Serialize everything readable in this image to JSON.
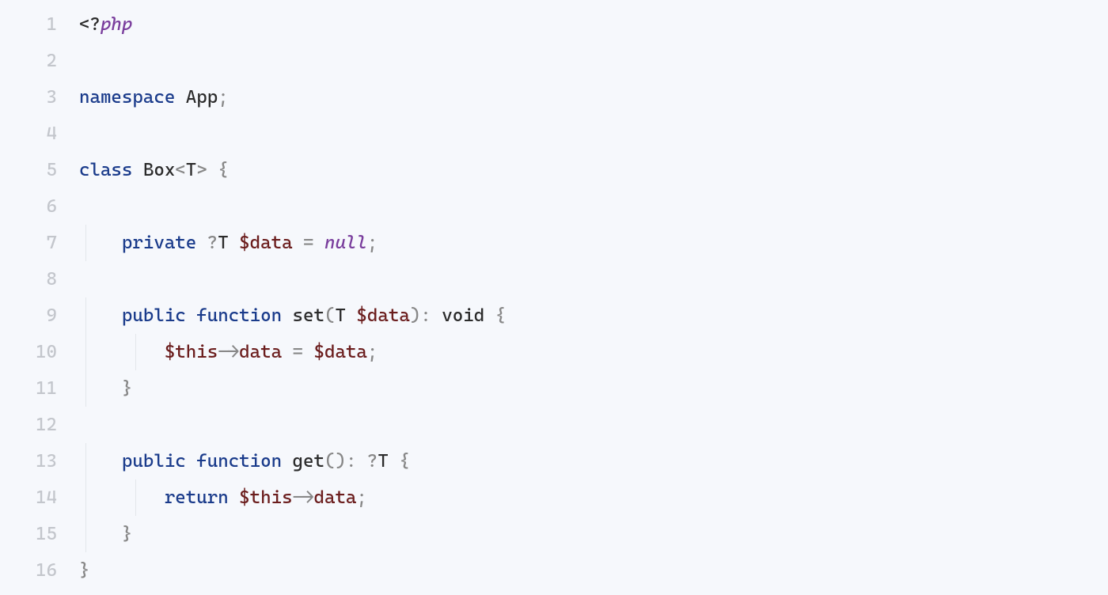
{
  "editor": {
    "lines": [
      {
        "num": "1",
        "guides": [],
        "tokens": [
          {
            "cls": "tk-tag",
            "t": "<?"
          },
          {
            "cls": "tk-php",
            "t": "php"
          }
        ]
      },
      {
        "num": "2",
        "guides": [],
        "tokens": []
      },
      {
        "num": "3",
        "guides": [],
        "tokens": [
          {
            "cls": "tk-kw",
            "t": "namespace"
          },
          {
            "cls": "tk-plain",
            "t": " App"
          },
          {
            "cls": "tk-punc",
            "t": ";"
          }
        ]
      },
      {
        "num": "4",
        "guides": [],
        "tokens": []
      },
      {
        "num": "5",
        "guides": [],
        "tokens": [
          {
            "cls": "tk-kw",
            "t": "class"
          },
          {
            "cls": "tk-plain",
            "t": " Box"
          },
          {
            "cls": "tk-punc",
            "t": "<"
          },
          {
            "cls": "tk-plain",
            "t": "T"
          },
          {
            "cls": "tk-punc",
            "t": ">"
          },
          {
            "cls": "tk-plain",
            "t": " "
          },
          {
            "cls": "tk-brace",
            "t": "{"
          }
        ]
      },
      {
        "num": "6",
        "guides": [
          "ig1"
        ],
        "tokens": []
      },
      {
        "num": "7",
        "guides": [
          "ig1"
        ],
        "tokens": [
          {
            "cls": "tk-plain",
            "t": "    "
          },
          {
            "cls": "tk-kw",
            "t": "private"
          },
          {
            "cls": "tk-plain",
            "t": " "
          },
          {
            "cls": "tk-punc",
            "t": "?"
          },
          {
            "cls": "tk-plain",
            "t": "T "
          },
          {
            "cls": "tk-var",
            "t": "$data"
          },
          {
            "cls": "tk-plain",
            "t": " "
          },
          {
            "cls": "tk-op",
            "t": "="
          },
          {
            "cls": "tk-plain",
            "t": " "
          },
          {
            "cls": "tk-null",
            "t": "null"
          },
          {
            "cls": "tk-punc",
            "t": ";"
          }
        ]
      },
      {
        "num": "8",
        "guides": [
          "ig1"
        ],
        "tokens": []
      },
      {
        "num": "9",
        "guides": [
          "ig1"
        ],
        "tokens": [
          {
            "cls": "tk-plain",
            "t": "    "
          },
          {
            "cls": "tk-kw",
            "t": "public"
          },
          {
            "cls": "tk-plain",
            "t": " "
          },
          {
            "cls": "tk-kw",
            "t": "function"
          },
          {
            "cls": "tk-plain",
            "t": " "
          },
          {
            "cls": "tk-func",
            "t": "set"
          },
          {
            "cls": "tk-punc",
            "t": "("
          },
          {
            "cls": "tk-plain",
            "t": "T "
          },
          {
            "cls": "tk-var",
            "t": "$data"
          },
          {
            "cls": "tk-punc",
            "t": ")"
          },
          {
            "cls": "tk-punc",
            "t": ":"
          },
          {
            "cls": "tk-plain",
            "t": " void "
          },
          {
            "cls": "tk-brace",
            "t": "{"
          }
        ]
      },
      {
        "num": "10",
        "guides": [
          "ig1",
          "ig2"
        ],
        "tokens": [
          {
            "cls": "tk-plain",
            "t": "        "
          },
          {
            "cls": "tk-var",
            "t": "$this"
          },
          {
            "cls": "tk-op",
            "t": "->"
          },
          {
            "cls": "tk-prop",
            "t": "data"
          },
          {
            "cls": "tk-plain",
            "t": " "
          },
          {
            "cls": "tk-op",
            "t": "="
          },
          {
            "cls": "tk-plain",
            "t": " "
          },
          {
            "cls": "tk-var",
            "t": "$data"
          },
          {
            "cls": "tk-punc",
            "t": ";"
          }
        ]
      },
      {
        "num": "11",
        "guides": [
          "ig1"
        ],
        "tokens": [
          {
            "cls": "tk-plain",
            "t": "    "
          },
          {
            "cls": "tk-brace",
            "t": "}"
          }
        ]
      },
      {
        "num": "12",
        "guides": [
          "ig1"
        ],
        "tokens": []
      },
      {
        "num": "13",
        "guides": [
          "ig1"
        ],
        "tokens": [
          {
            "cls": "tk-plain",
            "t": "    "
          },
          {
            "cls": "tk-kw",
            "t": "public"
          },
          {
            "cls": "tk-plain",
            "t": " "
          },
          {
            "cls": "tk-kw",
            "t": "function"
          },
          {
            "cls": "tk-plain",
            "t": " "
          },
          {
            "cls": "tk-func",
            "t": "get"
          },
          {
            "cls": "tk-punc",
            "t": "()"
          },
          {
            "cls": "tk-punc",
            "t": ":"
          },
          {
            "cls": "tk-plain",
            "t": " "
          },
          {
            "cls": "tk-punc",
            "t": "?"
          },
          {
            "cls": "tk-plain",
            "t": "T "
          },
          {
            "cls": "tk-brace",
            "t": "{"
          }
        ]
      },
      {
        "num": "14",
        "guides": [
          "ig1",
          "ig2"
        ],
        "tokens": [
          {
            "cls": "tk-plain",
            "t": "        "
          },
          {
            "cls": "tk-kw",
            "t": "return"
          },
          {
            "cls": "tk-plain",
            "t": " "
          },
          {
            "cls": "tk-var",
            "t": "$this"
          },
          {
            "cls": "tk-op",
            "t": "->"
          },
          {
            "cls": "tk-prop",
            "t": "data"
          },
          {
            "cls": "tk-punc",
            "t": ";"
          }
        ]
      },
      {
        "num": "15",
        "guides": [
          "ig1"
        ],
        "tokens": [
          {
            "cls": "tk-plain",
            "t": "    "
          },
          {
            "cls": "tk-brace",
            "t": "}"
          }
        ]
      },
      {
        "num": "16",
        "guides": [],
        "tokens": [
          {
            "cls": "tk-brace",
            "t": "}"
          }
        ]
      }
    ]
  }
}
